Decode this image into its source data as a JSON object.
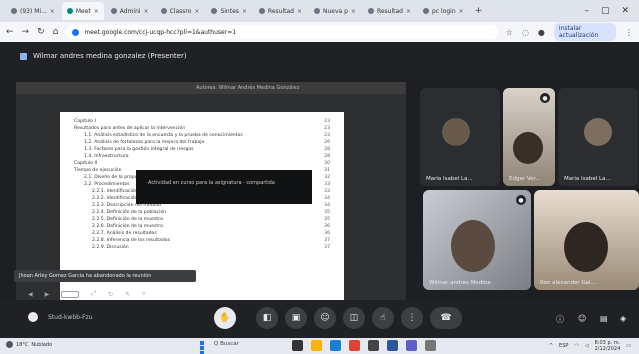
{
  "browser": {
    "tabs": [
      {
        "label": "(93) Mi...",
        "active": false
      },
      {
        "label": "Meet",
        "active": true
      },
      {
        "label": "Admini",
        "active": false
      },
      {
        "label": "Classro",
        "active": false
      },
      {
        "label": "Sintes",
        "active": false
      },
      {
        "label": "Resultad",
        "active": false
      },
      {
        "label": "Nueva p",
        "active": false
      },
      {
        "label": "Resultad",
        "active": false
      },
      {
        "label": "pc login",
        "active": false
      }
    ],
    "new_tab_symbol": "+",
    "url": "meet.google.com/ccj-ucqp-hcc?pli=1&authuser=1",
    "update_label": "Instalar actualización"
  },
  "meeting": {
    "presenter_title": "Wilmar andres medina gonzalez (Presenter)",
    "meeting_code": "Stud-kwbb-Fzu",
    "join_notice": "Jhoan Arley Gomez Garcia ha abandonado la reunión"
  },
  "document": {
    "toolbar_text": "Autores: Wilmar Andrés Medina González",
    "overlay_text": "Actividad en curso para la asignatura · compartida",
    "toc": [
      {
        "level": 1,
        "text": "Capítulo I",
        "page": "23"
      },
      {
        "level": 1,
        "text": "Resultados para antes de aplicar la intervención",
        "page": "23"
      },
      {
        "level": 2,
        "text": "1.1. Análisis estadístico de la encuesta y la prueba de conocimientos",
        "page": "23"
      },
      {
        "level": 2,
        "text": "1.2. Análisis de fortalezas para la mejora del trabajo",
        "page": "26"
      },
      {
        "level": 2,
        "text": "1.3. Factores para la gestión integral de riesgos",
        "page": "28"
      },
      {
        "level": 2,
        "text": "1.4. Infraestructura",
        "page": "28"
      },
      {
        "level": 1,
        "text": "Capítulo II",
        "page": "30"
      },
      {
        "level": 1,
        "text": "Tiempo de ejecución",
        "page": "31"
      },
      {
        "level": 2,
        "text": "2.1. Diseño de la propuesta de acuerdo a los resultados",
        "page": "32"
      },
      {
        "level": 2,
        "text": "2.2. Procedimientos",
        "page": "33"
      },
      {
        "level": 3,
        "text": "2.2.1. Identificación de las necesidades",
        "page": "33"
      },
      {
        "level": 3,
        "text": "2.2.2. Identificación de fases de las necesidades",
        "page": "34"
      },
      {
        "level": 3,
        "text": "2.2.3. Descripción del método",
        "page": "34"
      },
      {
        "level": 3,
        "text": "2.2.4. Definición de la población",
        "page": "35"
      },
      {
        "level": 3,
        "text": "2.2.5. Definición de la muestra",
        "page": "35"
      },
      {
        "level": 3,
        "text": "2.2.6. Definición de la muestra",
        "page": "36"
      },
      {
        "level": 3,
        "text": "2.2.7. Análisis de resultados",
        "page": "36"
      },
      {
        "level": 3,
        "text": "2.2.8. Inferencia de los resultados",
        "page": "37"
      },
      {
        "level": 3,
        "text": "2.2.9. Discusión",
        "page": "37"
      }
    ]
  },
  "participants": [
    {
      "name": "Maria Isabel La...",
      "muted": false
    },
    {
      "name": "Edgar Ver...",
      "muted": true
    },
    {
      "name": "Maria Isabel La...",
      "muted": false
    },
    {
      "name": "Wilmar andres Medina",
      "muted": true
    },
    {
      "name": "Ron alexander Gal...",
      "muted": false
    }
  ],
  "controls": {
    "mic_icon": "mic-icon",
    "camera_icon": "camera-icon",
    "captions_icon": "captions-icon",
    "emoji_icon": "emoji-icon",
    "present_icon": "present-icon",
    "hand_icon": "hand-icon",
    "more_icon": "more-icon",
    "end_call_icon": "end-call-icon"
  },
  "taskbar": {
    "weather": "18°C",
    "weather_sub": "Nublado",
    "search_label": "Q Buscar",
    "lang": "ESP",
    "time": "8:03 p. m.",
    "date": "2/12/2024"
  },
  "colors": {
    "meet_bg": "#202124",
    "button_bg": "#3c4043",
    "accent_blue": "#8ab4f8"
  }
}
